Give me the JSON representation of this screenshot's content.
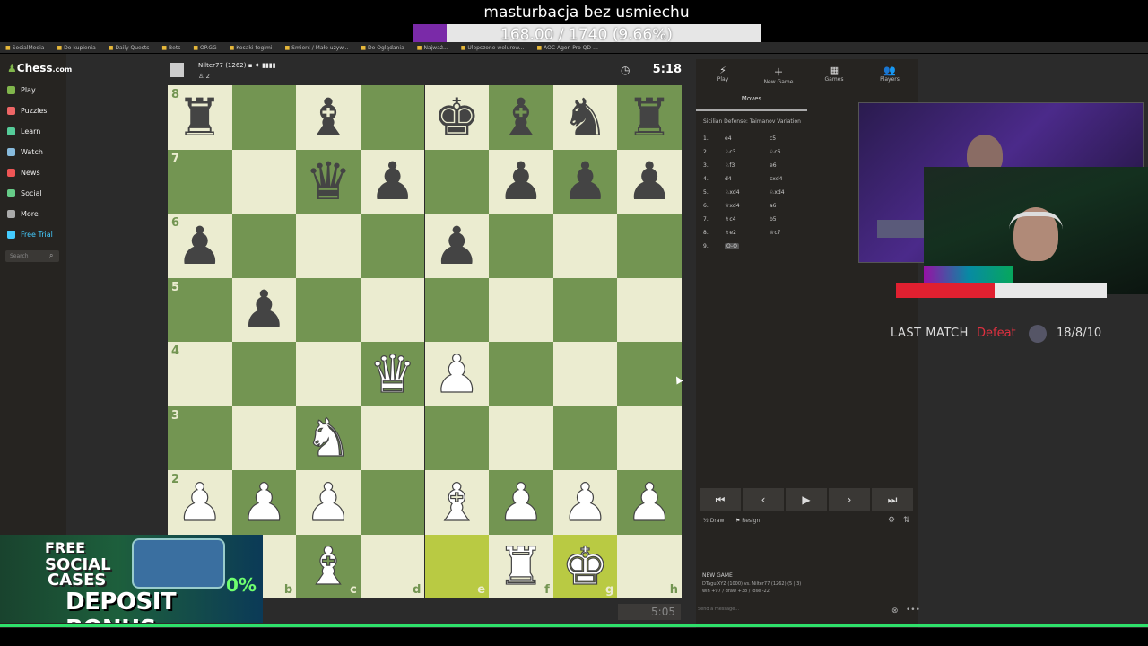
{
  "overlay": {
    "title": "masturbacja bez usmiechu",
    "goal_text": "168.00 / 1740 (9.66%)",
    "goal_fraction": 0.0966,
    "goal_color": "#7a2aa8"
  },
  "bookmarks": [
    "SocialMedia",
    "Do kupienia",
    "Daily Quests",
    "Bets",
    "OP.GG",
    "Kosaki tegimi",
    "Smierć / Mało używ...",
    "Do Oglądania",
    "Najważ...",
    "Ulepszone welurow...",
    "AOC Agon Pro QD-..."
  ],
  "chesscom": {
    "logo_prefix": "Chess",
    "logo_suffix": ".com",
    "nav": [
      {
        "label": "Play",
        "icon": "play-icon",
        "color": "#81b64c"
      },
      {
        "label": "Puzzles",
        "icon": "puzzle-icon",
        "color": "#e66"
      },
      {
        "label": "Learn",
        "icon": "learn-icon",
        "color": "#5c9"
      },
      {
        "label": "Watch",
        "icon": "watch-icon",
        "color": "#8bd"
      },
      {
        "label": "News",
        "icon": "news-icon",
        "color": "#e55"
      },
      {
        "label": "Social",
        "icon": "social-icon",
        "color": "#6c8"
      },
      {
        "label": "More",
        "icon": "more-icon",
        "color": "#aaa"
      },
      {
        "label": "Free Trial",
        "icon": "diamond-icon",
        "color": "#4cf"
      }
    ],
    "search_placeholder": "Search"
  },
  "top_player": {
    "name": "Nilter77 (1262) ▪ ♦ ▮▮▮▮",
    "sub": "♙ 2",
    "clock": "5:18"
  },
  "bottom_player": {
    "clock": "5:05"
  },
  "board": {
    "ranks": [
      "8",
      "7",
      "6",
      "5",
      "4",
      "3",
      "2"
    ],
    "files": [
      "b",
      "c",
      "d",
      "e",
      "f",
      "g",
      "h"
    ],
    "rows": [
      [
        "r",
        "",
        "b",
        "",
        "k",
        "b",
        "n",
        "r"
      ],
      [
        "",
        "",
        "q",
        "p",
        "",
        "p",
        "p",
        "p"
      ],
      [
        "p",
        "",
        "",
        "",
        "p",
        "",
        "",
        ""
      ],
      [
        "",
        "p",
        "",
        "",
        "",
        "",
        "",
        ""
      ],
      [
        "",
        "",
        "",
        "Q",
        "P",
        "",
        "",
        ""
      ],
      [
        "",
        "",
        "N",
        "",
        "",
        "",
        "",
        ""
      ],
      [
        "P",
        "P",
        "P",
        "",
        "B",
        "P",
        "P",
        "P"
      ],
      [
        "",
        "",
        "B",
        "",
        "",
        "R",
        "K",
        ""
      ]
    ],
    "highlighted": [
      "e1",
      "g1"
    ]
  },
  "panel": {
    "tabs": [
      {
        "label": "Play",
        "icon": "play-tab-icon",
        "glyph": "⚡"
      },
      {
        "label": "New Game",
        "icon": "new-game-icon",
        "glyph": "＋"
      },
      {
        "label": "Games",
        "icon": "games-icon",
        "glyph": "▦"
      },
      {
        "label": "Players",
        "icon": "players-icon",
        "glyph": "👥"
      }
    ],
    "moves_tab": "Moves",
    "opening": "Sicilian Defense: Taimanov Variation",
    "moves": [
      {
        "n": "1.",
        "w": "e4",
        "b": "c5"
      },
      {
        "n": "2.",
        "w": "♘c3",
        "b": "♘c6"
      },
      {
        "n": "3.",
        "w": "♘f3",
        "b": "e6"
      },
      {
        "n": "4.",
        "w": "d4",
        "b": "cxd4"
      },
      {
        "n": "5.",
        "w": "♘xd4",
        "b": "♘xd4"
      },
      {
        "n": "6.",
        "w": "♕xd4",
        "b": "a6"
      },
      {
        "n": "7.",
        "w": "♗c4",
        "b": "b5"
      },
      {
        "n": "8.",
        "w": "♗e2",
        "b": "♕c7"
      },
      {
        "n": "9.",
        "w": "O-O",
        "b": ""
      }
    ],
    "nav_buttons": [
      "⏮",
      "‹",
      "▶",
      "›",
      "⏭"
    ],
    "draw": "Draw",
    "resign": "Resign",
    "new_game_label": "NEW GAME",
    "game_line": "DTaguiXYZ (1000) vs. Nilter77 (1262) (5 | 3)",
    "game_line2": "win +97 / draw +38 / lose -22",
    "chat_placeholder": "Send a message..."
  },
  "stream": {
    "last_match_label": "LAST MATCH",
    "last_match_result": "Defeat",
    "kda": "18/8/10",
    "bar_fraction": 0.47
  },
  "promo": {
    "line1": "FREE",
    "line2": "SOCIAL",
    "line3": "CASES",
    "percent": "0%",
    "bonus": "DEPOSIT BONUS"
  }
}
